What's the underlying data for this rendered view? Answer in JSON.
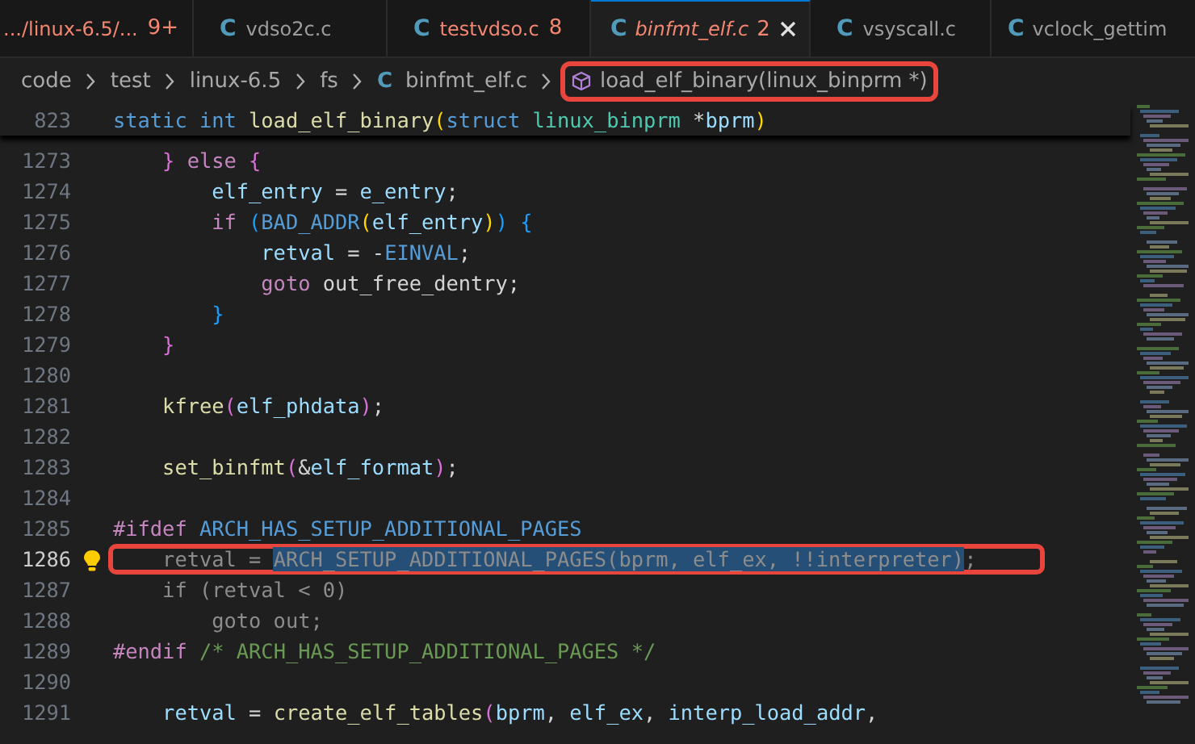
{
  "tabs": [
    {
      "label": ".../linux-6.5/...",
      "badge": "9+",
      "error": true,
      "preview": false,
      "selected": false
    },
    {
      "icon": "C",
      "label": "vdso2c.c",
      "error": false,
      "preview": false,
      "selected": false
    },
    {
      "icon": "C",
      "label": "testvdso.c",
      "badge": "8",
      "error": true,
      "preview": false,
      "selected": false
    },
    {
      "icon": "C",
      "label": "binfmt_elf.c",
      "badge": "2",
      "error": true,
      "preview": true,
      "selected": true
    },
    {
      "icon": "C",
      "label": "vsyscall.c",
      "error": false,
      "preview": false,
      "selected": false
    },
    {
      "icon": "C",
      "label": "vclock_gettim",
      "error": false,
      "preview": false,
      "selected": false
    }
  ],
  "breadcrumb": [
    {
      "kind": "folder",
      "label": "code",
      "outlined": false
    },
    {
      "kind": "folder",
      "label": "test",
      "outlined": false
    },
    {
      "kind": "folder",
      "label": "linux-6.5",
      "outlined": false
    },
    {
      "kind": "folder",
      "label": "fs",
      "outlined": false
    },
    {
      "kind": "file",
      "icon": "C",
      "label": "binfmt_elf.c",
      "outlined": false
    },
    {
      "kind": "symbol",
      "label": "load_elf_binary(linux_binprm *)",
      "outlined": true
    }
  ],
  "sticky_line": {
    "number": "823",
    "tokens": [
      {
        "text": "static int ",
        "kind": "keyword"
      },
      {
        "text": "load_elf_binary",
        "kind": "func"
      },
      {
        "text": "(",
        "kind": "b1"
      },
      {
        "text": "struct ",
        "kind": "keyword"
      },
      {
        "text": "linux_binprm ",
        "kind": "type"
      },
      {
        "text": "*",
        "kind": "plain"
      },
      {
        "text": "bprm",
        "kind": "var"
      },
      {
        "text": ")",
        "kind": "b1"
      }
    ]
  },
  "lines": [
    {
      "number": "1273",
      "active": false,
      "outlined": false,
      "tokens": [
        {
          "text": "    } ",
          "kind": "b2"
        },
        {
          "text": "else ",
          "kind": "control"
        },
        {
          "text": "{",
          "kind": "b2"
        }
      ]
    },
    {
      "number": "1274",
      "active": false,
      "outlined": false,
      "tokens": [
        {
          "text": "        elf_entry",
          "kind": "var"
        },
        {
          "text": " = ",
          "kind": "plain"
        },
        {
          "text": "e_entry",
          "kind": "var"
        },
        {
          "text": ";",
          "kind": "plain"
        }
      ]
    },
    {
      "number": "1275",
      "active": false,
      "outlined": false,
      "tokens": [
        {
          "text": "        if ",
          "kind": "control"
        },
        {
          "text": "(",
          "kind": "b3"
        },
        {
          "text": "BAD_ADDR",
          "kind": "macro"
        },
        {
          "text": "(",
          "kind": "b1"
        },
        {
          "text": "elf_entry",
          "kind": "var"
        },
        {
          "text": ")",
          "kind": "b1"
        },
        {
          "text": ") {",
          "kind": "b3"
        }
      ]
    },
    {
      "number": "1276",
      "active": false,
      "outlined": false,
      "tokens": [
        {
          "text": "            retval",
          "kind": "var"
        },
        {
          "text": " = -",
          "kind": "plain"
        },
        {
          "text": "EINVAL",
          "kind": "macro"
        },
        {
          "text": ";",
          "kind": "plain"
        }
      ]
    },
    {
      "number": "1277",
      "active": false,
      "outlined": false,
      "tokens": [
        {
          "text": "            goto ",
          "kind": "control"
        },
        {
          "text": "out_free_dentry;",
          "kind": "plain"
        }
      ]
    },
    {
      "number": "1278",
      "active": false,
      "outlined": false,
      "tokens": [
        {
          "text": "        }",
          "kind": "b3"
        }
      ]
    },
    {
      "number": "1279",
      "active": false,
      "outlined": false,
      "tokens": [
        {
          "text": "    }",
          "kind": "b2"
        }
      ]
    },
    {
      "number": "1280",
      "active": false,
      "outlined": false
    },
    {
      "number": "1281",
      "active": false,
      "outlined": false,
      "tokens": [
        {
          "text": "    kfree",
          "kind": "func"
        },
        {
          "text": "(",
          "kind": "b2"
        },
        {
          "text": "elf_phdata",
          "kind": "var"
        },
        {
          "text": ")",
          "kind": "b2"
        },
        {
          "text": ";",
          "kind": "plain"
        }
      ]
    },
    {
      "number": "1282",
      "active": false,
      "outlined": false
    },
    {
      "number": "1283",
      "active": false,
      "outlined": false,
      "tokens": [
        {
          "text": "    set_binfmt",
          "kind": "func"
        },
        {
          "text": "(",
          "kind": "b2"
        },
        {
          "text": "&",
          "kind": "plain"
        },
        {
          "text": "elf_format",
          "kind": "var"
        },
        {
          "text": ")",
          "kind": "b2"
        },
        {
          "text": ";",
          "kind": "plain"
        }
      ]
    },
    {
      "number": "1284",
      "active": false,
      "outlined": false
    },
    {
      "number": "1285",
      "active": false,
      "outlined": false,
      "tokens": [
        {
          "text": "#ifdef ",
          "kind": "control"
        },
        {
          "text": "ARCH_HAS_SETUP_ADDITIONAL_PAGES",
          "kind": "macro"
        }
      ]
    },
    {
      "number": "1286",
      "active": true,
      "outlined": true,
      "tokens": [
        {
          "text": "    retval = ",
          "kind": "dim"
        },
        {
          "text": "ARCH_SETUP_ADDITIONAL_PAGES(bprm, elf_ex, !!interpreter)",
          "kind": "selection"
        },
        {
          "text": ";",
          "kind": "dim"
        }
      ]
    },
    {
      "number": "1287",
      "active": false,
      "outlined": false,
      "tokens": [
        {
          "text": "    if (retval < 0)",
          "kind": "dim"
        }
      ]
    },
    {
      "number": "1288",
      "active": false,
      "outlined": false,
      "tokens": [
        {
          "text": "        goto out;",
          "kind": "dim"
        }
      ]
    },
    {
      "number": "1289",
      "active": false,
      "outlined": false,
      "tokens": [
        {
          "text": "#endif ",
          "kind": "control"
        },
        {
          "text": "/* ARCH_HAS_SETUP_ADDITIONAL_PAGES */",
          "kind": "comment"
        }
      ]
    },
    {
      "number": "1290",
      "active": false,
      "outlined": false
    },
    {
      "number": "1291",
      "active": false,
      "outlined": false,
      "tokens": [
        {
          "text": "    retval",
          "kind": "var"
        },
        {
          "text": " = ",
          "kind": "plain"
        },
        {
          "text": "create_elf_tables",
          "kind": "func"
        },
        {
          "text": "(",
          "kind": "b2"
        },
        {
          "text": "bprm",
          "kind": "var"
        },
        {
          "text": ", ",
          "kind": "plain"
        },
        {
          "text": "elf_ex",
          "kind": "var"
        },
        {
          "text": ", ",
          "kind": "plain"
        },
        {
          "text": "interp_load_addr",
          "kind": "var"
        },
        {
          "text": ",",
          "kind": "plain"
        }
      ]
    }
  ]
}
